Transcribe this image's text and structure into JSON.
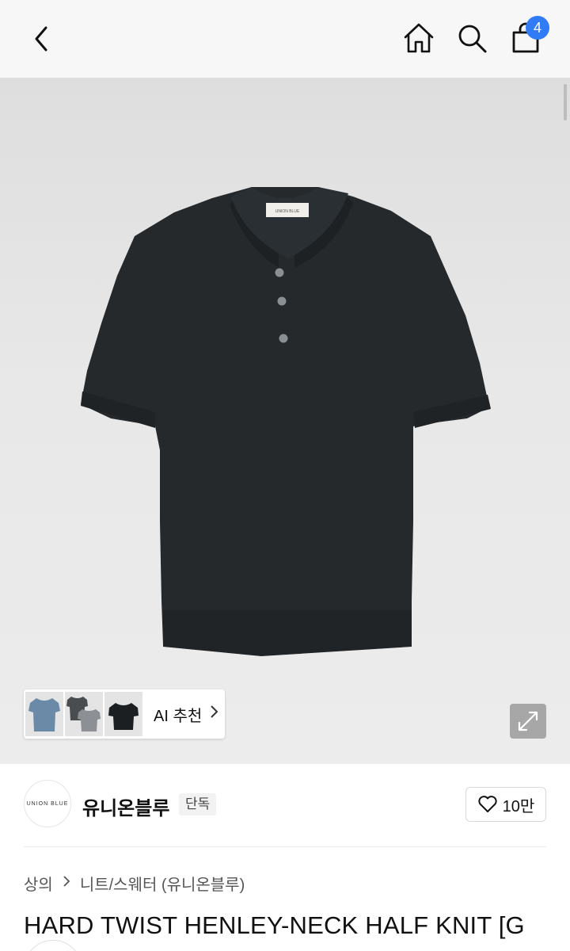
{
  "header": {
    "cart_count": "4"
  },
  "gallery": {
    "ai_recommend_label": "AI 추천",
    "label_text": "UNION BLUE"
  },
  "brand": {
    "logo_text": "UNION BLUE",
    "name": "유니온블루",
    "exclusive_badge": "단독",
    "likes": "10만"
  },
  "breadcrumb": {
    "category": "상의",
    "subcategory": "니트/스웨터 (유니온블루)"
  },
  "product": {
    "title": "HARD TWIST HENLEY-NECK HALF KNIT [G"
  },
  "colors": {
    "badge_blue": "#2f7cf6",
    "garment": "#25292c",
    "hero_bg": "#e6e6e6"
  }
}
